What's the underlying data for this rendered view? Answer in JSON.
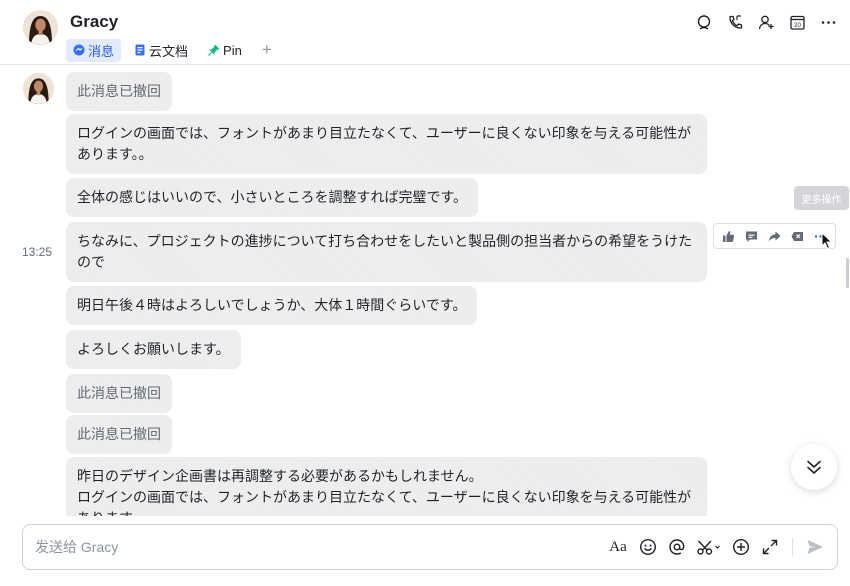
{
  "header": {
    "title": "Gracy",
    "tabs": [
      {
        "label": "消息",
        "icon": "chat-bubble-icon",
        "active": true
      },
      {
        "label": "云文档",
        "icon": "doc-icon",
        "active": false
      },
      {
        "label": "Pin",
        "icon": "pin-icon",
        "active": false
      }
    ],
    "add_tab": "+",
    "actions": [
      "search-icon",
      "phone-icon",
      "add-member-icon",
      "calendar-icon",
      "more-icon"
    ],
    "calendar_day": "20"
  },
  "timestamp": "13:25",
  "messages": [
    {
      "text": "此消息已撤回",
      "recalled": true
    },
    {
      "text": "ログインの画面では、フォントがあまり目立たなくて、ユーザーに良くない印象を与える可能性があります。。",
      "recalled": false
    },
    {
      "text": "全体の感じはいいので、小さいところを調整すれば完璧です。",
      "recalled": false
    },
    {
      "text": "ちなみに、プロジェクトの進捗について打ち合わせをしたいと製品側の担当者からの希望をうけたので",
      "recalled": false
    },
    {
      "text": "明日午後４時はよろしいでしょうか、大体１時間ぐらいです。",
      "recalled": false
    },
    {
      "text": "よろしくお願いします。",
      "recalled": false
    },
    {
      "text": "此消息已撤回",
      "recalled": true
    },
    {
      "text": "此消息已撤回",
      "recalled": true
    },
    {
      "text": "昨日のデザイン企画書は再調整する必要があるかもしれません。\nログインの画面では、フォントがあまり目立たなくて、ユーザーに良くない印象を与える可能性があります。",
      "recalled": false
    }
  ],
  "message_toolbar": {
    "buttons": [
      "thumbs-up-icon",
      "reply-icon",
      "forward-icon",
      "recall-icon",
      "more-icon"
    ],
    "tooltip": "更多操作"
  },
  "composer": {
    "placeholder": "发送给 Gracy",
    "tools": [
      "text-format-icon",
      "emoji-icon",
      "mention-icon",
      "scissors-icon",
      "plus-circle-icon",
      "expand-icon",
      "send-icon"
    ],
    "format_label": "Aa"
  },
  "colors": {
    "accent": "#245bdb",
    "active_tab_bg": "#e1eaff",
    "bubble_bg": "#ececec",
    "muted_text": "#646a73"
  }
}
